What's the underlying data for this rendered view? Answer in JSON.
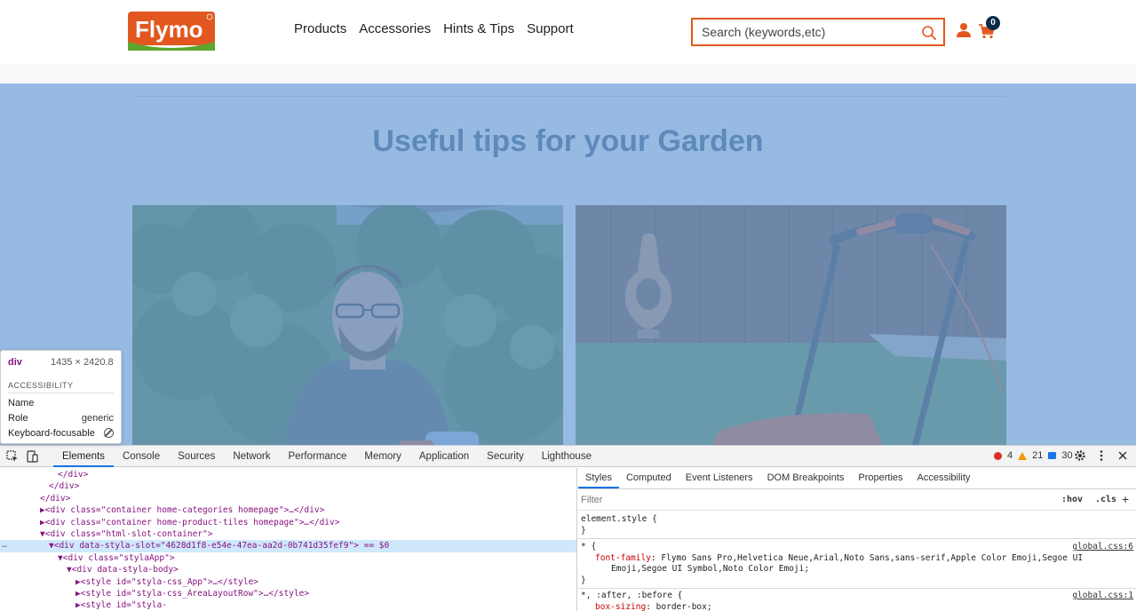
{
  "header": {
    "logo_text": "Flymo",
    "nav": [
      "Products",
      "Accessories",
      "Hints & Tips",
      "Support"
    ],
    "search_placeholder": "Search (keywords,etc)",
    "cart_count": "0",
    "brand_color": "#e2571f"
  },
  "content": {
    "title": "Useful tips for your Garden",
    "overlay_color": "#6fa0d7"
  },
  "inspector_tooltip": {
    "tag": "div",
    "size": "1435 × 2420.8",
    "section": "ACCESSIBILITY",
    "rows": [
      {
        "label": "Name",
        "value": ""
      },
      {
        "label": "Role",
        "value": "generic"
      },
      {
        "label": "Keyboard-focusable",
        "value": ""
      }
    ]
  },
  "devtools": {
    "tabs": [
      "Elements",
      "Console",
      "Sources",
      "Network",
      "Performance",
      "Memory",
      "Application",
      "Security",
      "Lighthouse"
    ],
    "active_tab": "Elements",
    "errors": "4",
    "warnings": "21",
    "messages": "30",
    "dom_lines": [
      {
        "indent": 5,
        "text": "</div>"
      },
      {
        "indent": 4,
        "text": "</div>"
      },
      {
        "indent": 3,
        "text": "</div>"
      },
      {
        "indent": 3,
        "text": "▶<div class=\"container home-categories homepage\">…</div>"
      },
      {
        "indent": 3,
        "text": "▶<div class=\"container home-product-tiles homepage\">…</div>"
      },
      {
        "indent": 3,
        "text": "▼<div class=\"html-slot-container\">"
      },
      {
        "indent": 4,
        "text": "▼<div data-styla-slot=\"4628d1f8-e54e-47ea-aa2d-0b741d35fef9\"> == $0"
      },
      {
        "indent": 5,
        "text": "▼<div class=\"stylaApp\">"
      },
      {
        "indent": 6,
        "text": "▼<div data-styla-body>"
      },
      {
        "indent": 7,
        "text": "▶<style id=\"styla-css_App\">…</style>"
      },
      {
        "indent": 7,
        "text": "▶<style id=\"styla-css_AreaLayoutRow\">…</style>"
      },
      {
        "indent": 7,
        "text": "▶<style id=\"styla-"
      }
    ],
    "styles_tabs": [
      "Styles",
      "Computed",
      "Event Listeners",
      "DOM Breakpoints",
      "Properties",
      "Accessibility"
    ],
    "filter_placeholder": "Filter",
    "hov": ":hov",
    "cls": ".cls",
    "plus": "+",
    "rules": {
      "element_style": "element.style {",
      "close": "}",
      "universal_selector": "* {",
      "universal_source": "global.css:6",
      "font_family_prop": "font-family",
      "font_family_val_1": "Flymo Sans Pro,Helvetica Neue,Arial,Noto Sans,sans-serif,Apple Color Emoji,Segoe UI",
      "font_family_val_2": "Emoji,Segoe UI Symbol,Noto Color Emoji;",
      "pseudo_selector": "*, :after, :before {",
      "pseudo_source": "global.css:1",
      "box_sizing_prop": "box-sizing",
      "box_sizing_val": "border-box;"
    }
  }
}
